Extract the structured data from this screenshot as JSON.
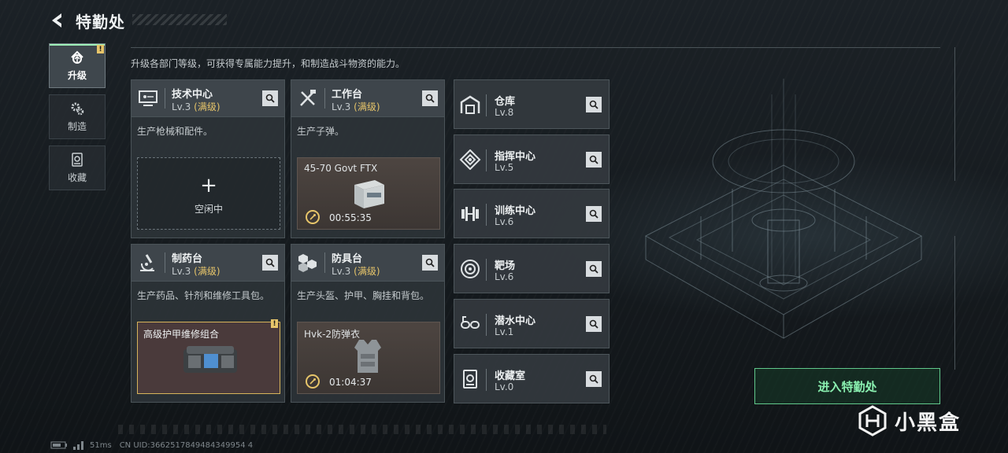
{
  "header": {
    "title": "特勤处"
  },
  "nav": [
    {
      "label": "升级",
      "icon": "upgrade-icon",
      "active": true,
      "badge": "!"
    },
    {
      "label": "制造",
      "icon": "gear-icon",
      "active": false
    },
    {
      "label": "收藏",
      "icon": "collection-icon",
      "active": false
    }
  ],
  "description": "升级各部门等级，可获得专属能力提升，和制造战斗物资的能力。",
  "cards": [
    {
      "name": "技术中心",
      "lv": "Lv.3",
      "max": "(满级)",
      "icon": "monitor-icon",
      "desc": "生产枪械和配件。",
      "slot": {
        "type": "idle",
        "plus": "+",
        "label": "空闲中"
      }
    },
    {
      "name": "工作台",
      "lv": "Lv.3",
      "max": "(满级)",
      "icon": "tools-icon",
      "desc": "生产子弹。",
      "slot": {
        "type": "production",
        "item": "45-70 Govt FTX",
        "timer": "00:55:35"
      }
    },
    {
      "name": "制药台",
      "lv": "Lv.3",
      "max": "(满级)",
      "icon": "microscope-icon",
      "desc": "生产药品、针剂和维修工具包。",
      "slot": {
        "type": "selected",
        "item": "高级护甲维修组合",
        "badge": "!"
      }
    },
    {
      "name": "防具台",
      "lv": "Lv.3",
      "max": "(满级)",
      "icon": "armor-blocks-icon",
      "desc": "生产头盔、护甲、胸挂和背包。",
      "slot": {
        "type": "production",
        "item": "Hvk-2防弹衣",
        "timer": "01:04:37"
      }
    }
  ],
  "facilities": [
    {
      "name": "仓库",
      "lv": "Lv.8",
      "icon": "warehouse-icon"
    },
    {
      "name": "指挥中心",
      "lv": "Lv.5",
      "icon": "command-icon"
    },
    {
      "name": "训练中心",
      "lv": "Lv.6",
      "icon": "dumbbell-icon"
    },
    {
      "name": "靶场",
      "lv": "Lv.6",
      "icon": "target-icon"
    },
    {
      "name": "潜水中心",
      "lv": "Lv.1",
      "icon": "diving-mask-icon"
    },
    {
      "name": "收藏室",
      "lv": "Lv.0",
      "icon": "collection-room-icon"
    }
  ],
  "enter_button": "进入特勤处",
  "watermark": "小黑盒",
  "footer": {
    "ping": "51ms",
    "uid": "CN UID:3662517849484349954 4"
  },
  "colors": {
    "accent_green": "#8af0b0",
    "max_level_gold": "#e7c56a"
  }
}
